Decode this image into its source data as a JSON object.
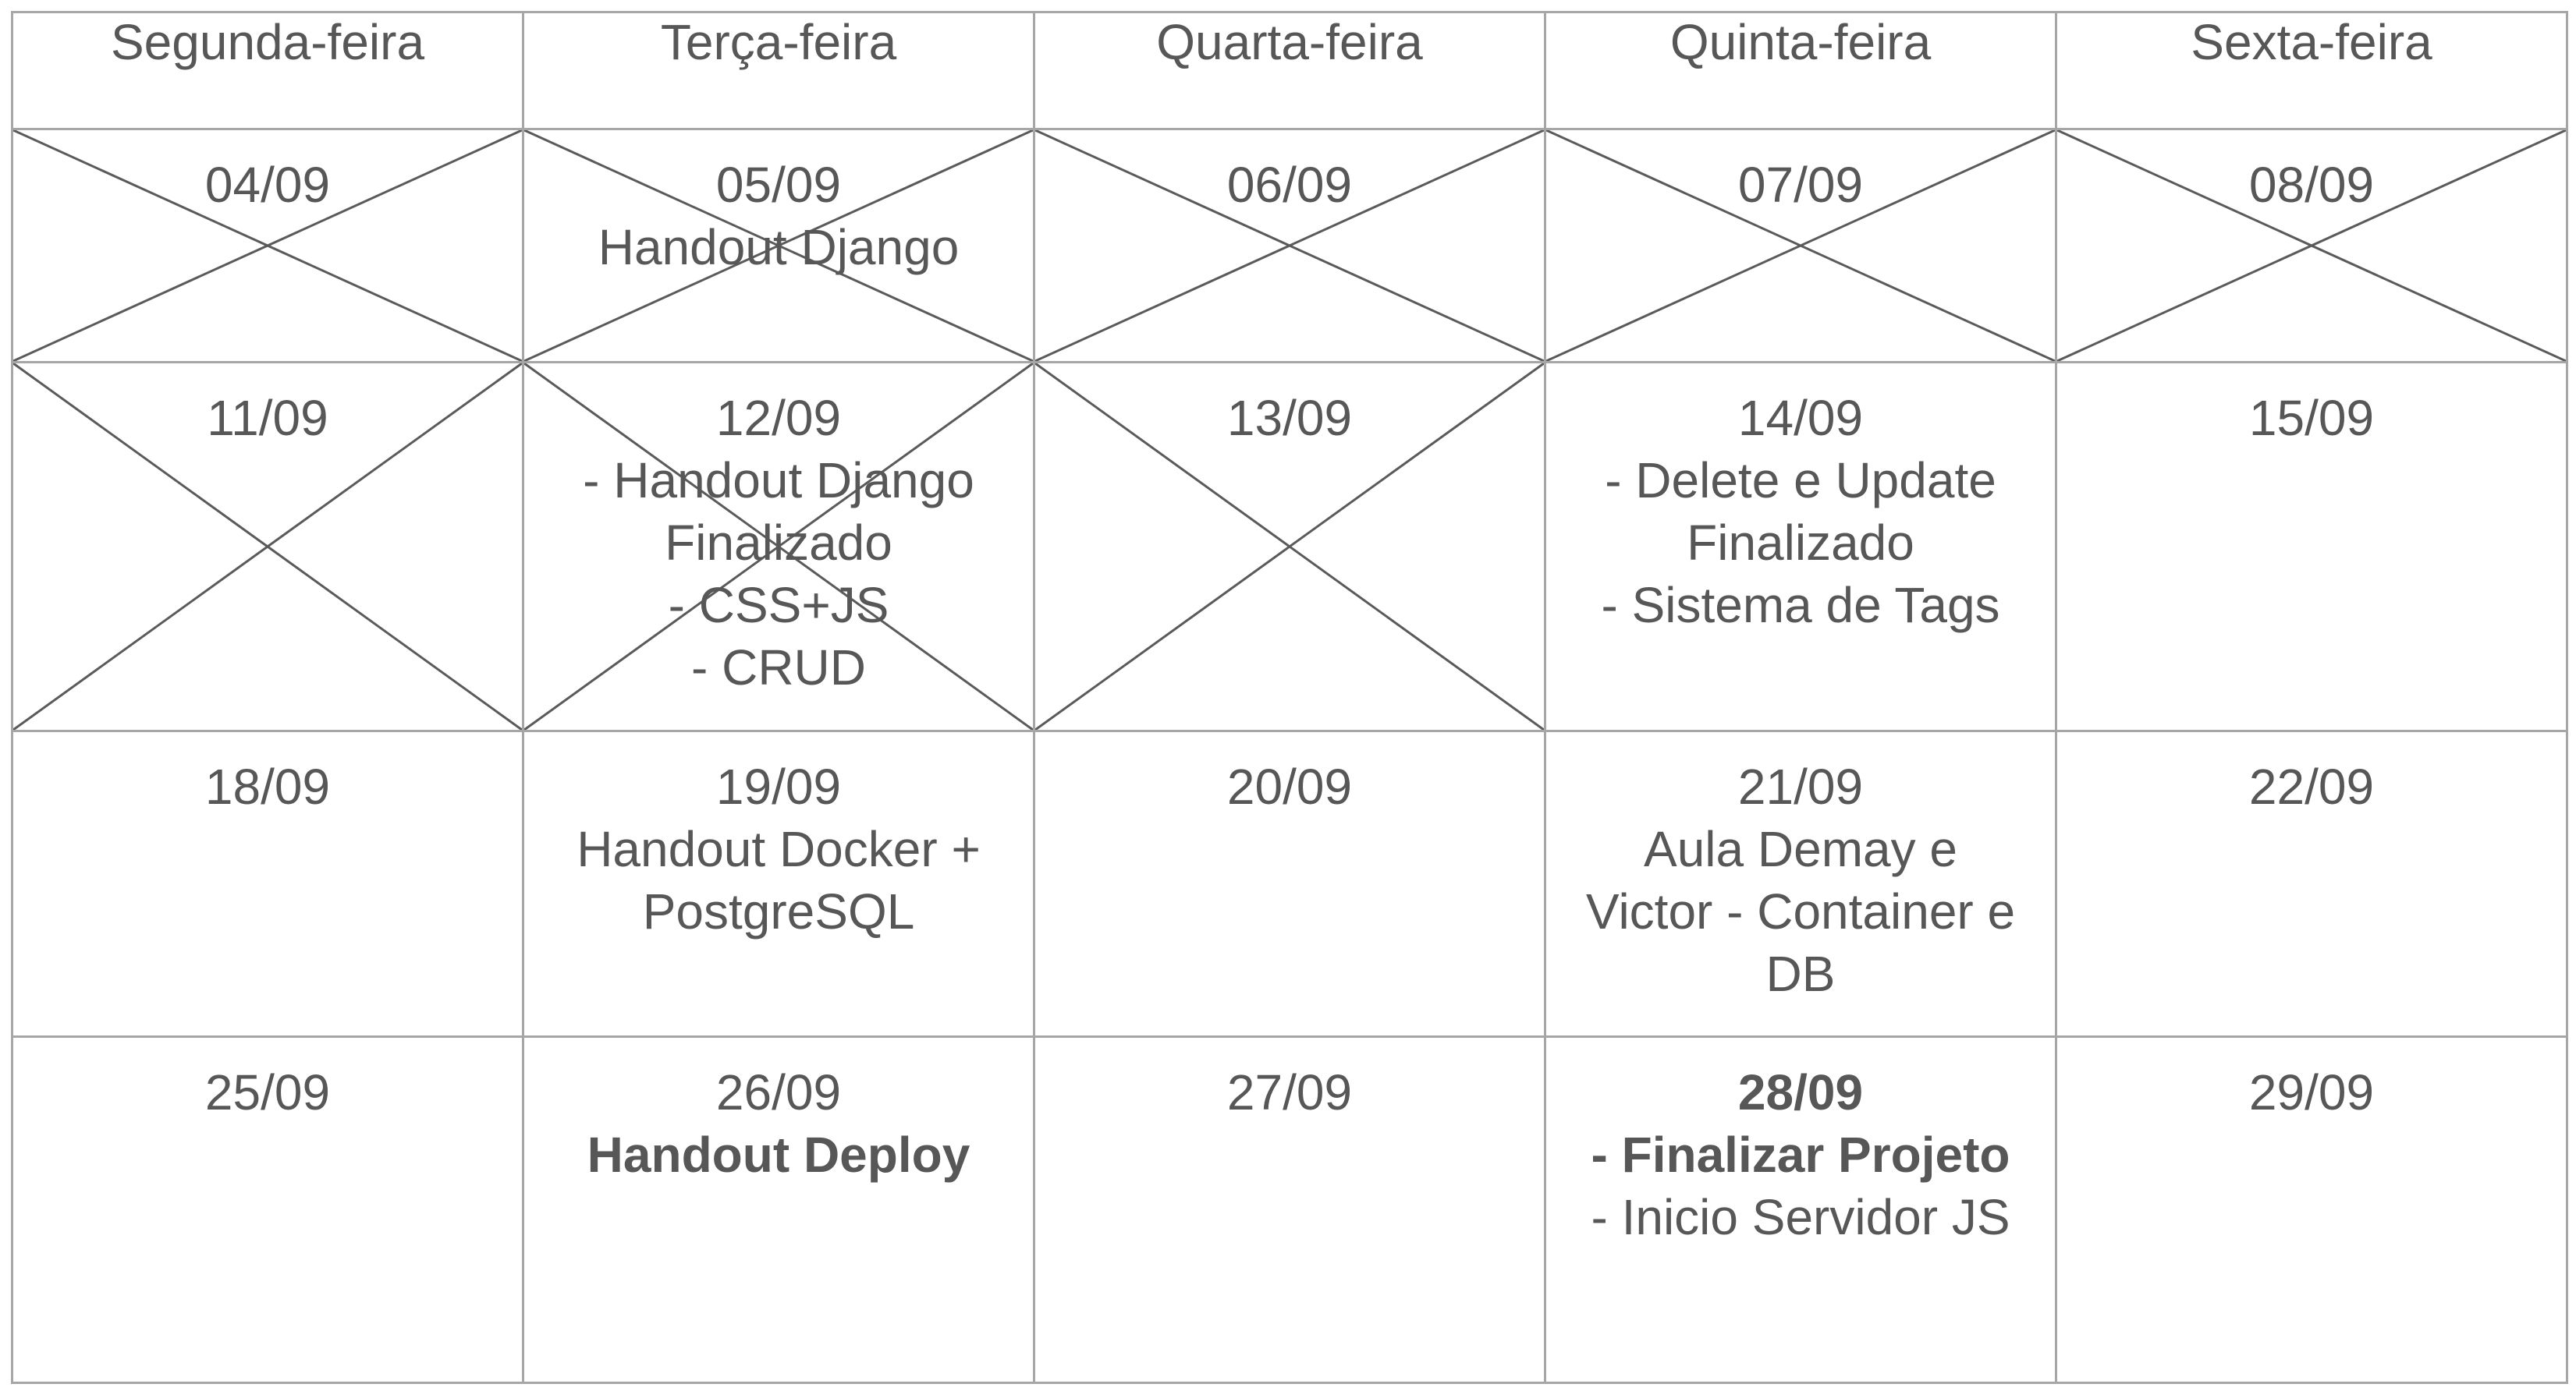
{
  "days": [
    "Segunda-feira",
    "Terça-feira",
    "Quarta-feira",
    "Quinta-feira",
    "Sexta-feira"
  ],
  "weeks": [
    {
      "cells": [
        {
          "date": "04/09",
          "lines": [],
          "crossed": true
        },
        {
          "date": "05/09",
          "lines": [
            "Handout Django"
          ],
          "crossed": true
        },
        {
          "date": "06/09",
          "lines": [],
          "crossed": true
        },
        {
          "date": "07/09",
          "lines": [],
          "crossed": true
        },
        {
          "date": "08/09",
          "lines": [],
          "crossed": true
        }
      ]
    },
    {
      "cells": [
        {
          "date": "11/09",
          "lines": [],
          "crossed": true
        },
        {
          "date": "12/09",
          "lines": [
            "- Handout Django",
            "Finalizado",
            "- CSS+JS",
            "- CRUD"
          ],
          "crossed": true
        },
        {
          "date": "13/09",
          "lines": [],
          "crossed": true
        },
        {
          "date": "14/09",
          "lines": [
            "- Delete e Update",
            "Finalizado",
            "- Sistema de Tags"
          ],
          "crossed": false
        },
        {
          "date": "15/09",
          "lines": [],
          "crossed": false
        }
      ]
    },
    {
      "cells": [
        {
          "date": "18/09",
          "lines": [],
          "crossed": false
        },
        {
          "date": "19/09",
          "lines": [
            "Handout Docker +",
            "PostgreSQL"
          ],
          "crossed": false
        },
        {
          "date": "20/09",
          "lines": [],
          "crossed": false
        },
        {
          "date": "21/09",
          "lines": [
            "Aula Demay e",
            "Victor - Container e",
            "DB"
          ],
          "crossed": false
        },
        {
          "date": "22/09",
          "lines": [],
          "crossed": false
        }
      ]
    },
    {
      "cells": [
        {
          "date": "25/09",
          "lines": [],
          "crossed": false
        },
        {
          "date": "26/09",
          "lines": [
            "Handout Deploy"
          ],
          "bold_lines": [
            0
          ],
          "crossed": false
        },
        {
          "date": "27/09",
          "lines": [],
          "crossed": false
        },
        {
          "date": "28/09",
          "date_bold": true,
          "lines": [
            "- Finalizar Projeto",
            "- Inicio Servidor JS"
          ],
          "bold_lines": [
            0
          ],
          "crossed": false
        },
        {
          "date": "29/09",
          "lines": [],
          "crossed": false
        }
      ]
    }
  ]
}
